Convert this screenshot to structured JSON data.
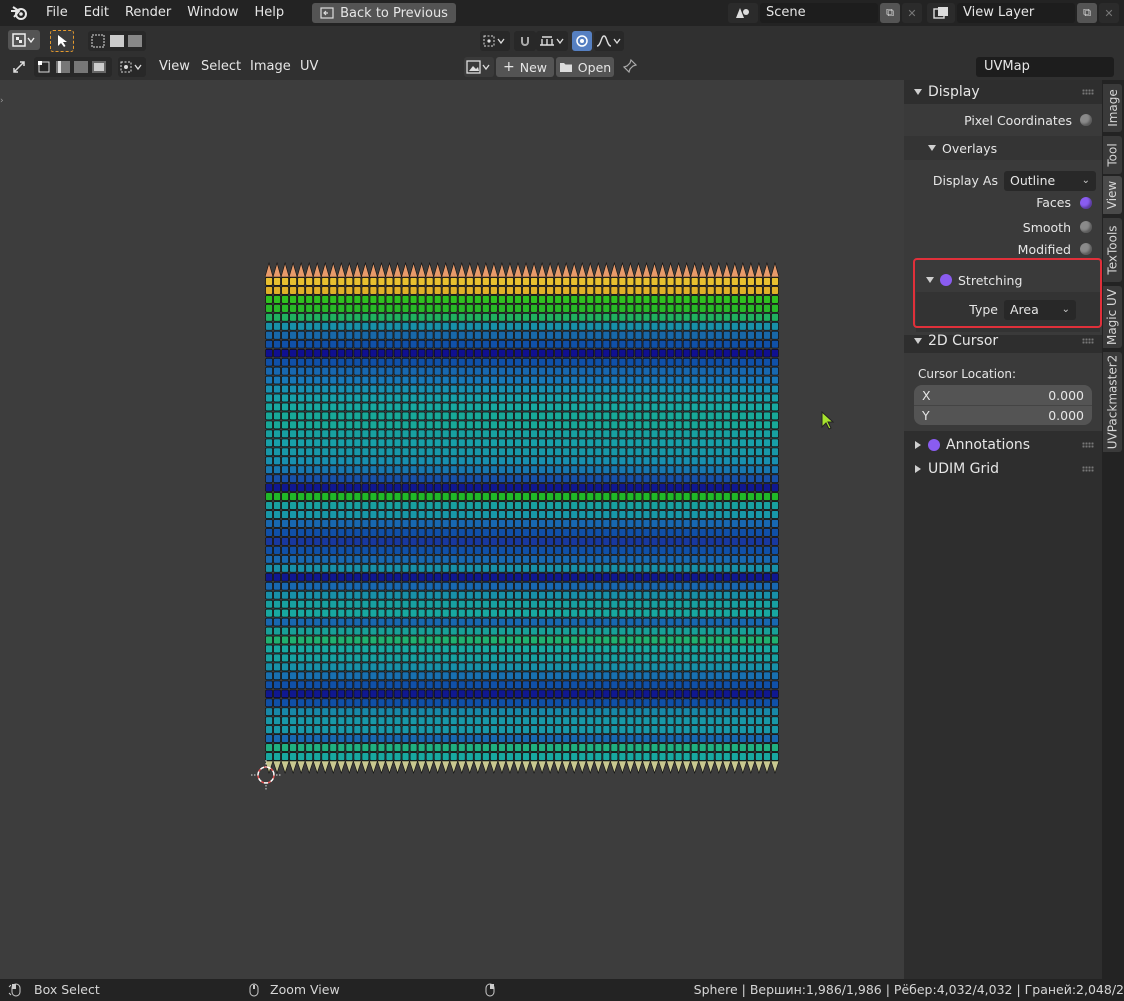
{
  "menubar": {
    "items": [
      "File",
      "Edit",
      "Render",
      "Window",
      "Help"
    ],
    "back_button": "Back to Previous",
    "scene": "Scene",
    "view_layer": "View Layer"
  },
  "header": {
    "menus": [
      "View",
      "Select",
      "Image",
      "UV"
    ],
    "new_label": "New",
    "open_label": "Open",
    "uvmap": "UVMap"
  },
  "sidebar": {
    "display": {
      "title": "Display",
      "pixel_coordinates": "Pixel Coordinates",
      "overlays": {
        "title": "Overlays",
        "display_as_label": "Display As",
        "display_as_value": "Outline",
        "faces": "Faces",
        "smooth": "Smooth",
        "modified": "Modified"
      },
      "stretching": {
        "title": "Stretching",
        "type_label": "Type",
        "type_value": "Area"
      }
    },
    "cursor": {
      "title": "2D Cursor",
      "location_label": "Cursor Location:",
      "x_label": "X",
      "x_value": "0.000",
      "y_label": "Y",
      "y_value": "0.000"
    },
    "annotations": "Annotations",
    "udim_grid": "UDIM Grid"
  },
  "tabs": [
    "Image",
    "Tool",
    "View",
    "TexTools",
    "Magic UV",
    "UVPackmaster2"
  ],
  "active_tab": "View",
  "statusbar": {
    "left": "Box Select",
    "middle": "Zoom View",
    "right": "Sphere | Вершин:1,986/1,986 | Рёбер:4,032/4,032 | Граней:2,048/2"
  },
  "colors": {
    "accent": "#5680c2",
    "highlight": "#e0303a",
    "toggle_on": "#8a5cf0"
  },
  "uv_rows": [
    "#e8c030",
    "#e0b028",
    "#30c020",
    "#28b828",
    "#20b060",
    "#1890a8",
    "#1868a8",
    "#1050a8",
    "#101090",
    "#1050a8",
    "#1868b0",
    "#1878b8",
    "#1890b0",
    "#18a0a8",
    "#18a8a0",
    "#18a898",
    "#18a898",
    "#18a0a0",
    "#18a0a8",
    "#1898a8",
    "#1890b0",
    "#1878b0",
    "#1850a8",
    "#101890",
    "#20b828",
    "#18a0a0",
    "#1898a8",
    "#1868b0",
    "#1050a8",
    "#1838a0",
    "#1050a8",
    "#1868b0",
    "#1890a8",
    "#101890",
    "#1868b0",
    "#1890a8",
    "#18a0a0",
    "#18a8a0",
    "#1868b0",
    "#18a098",
    "#20b070",
    "#18a8a0",
    "#18a0a0",
    "#1890a8",
    "#1870b0",
    "#1050a8",
    "#101890",
    "#1050a8",
    "#1888a8",
    "#1898a8",
    "#1898a8",
    "#1868b0",
    "#20b080",
    "#18a8a0"
  ]
}
